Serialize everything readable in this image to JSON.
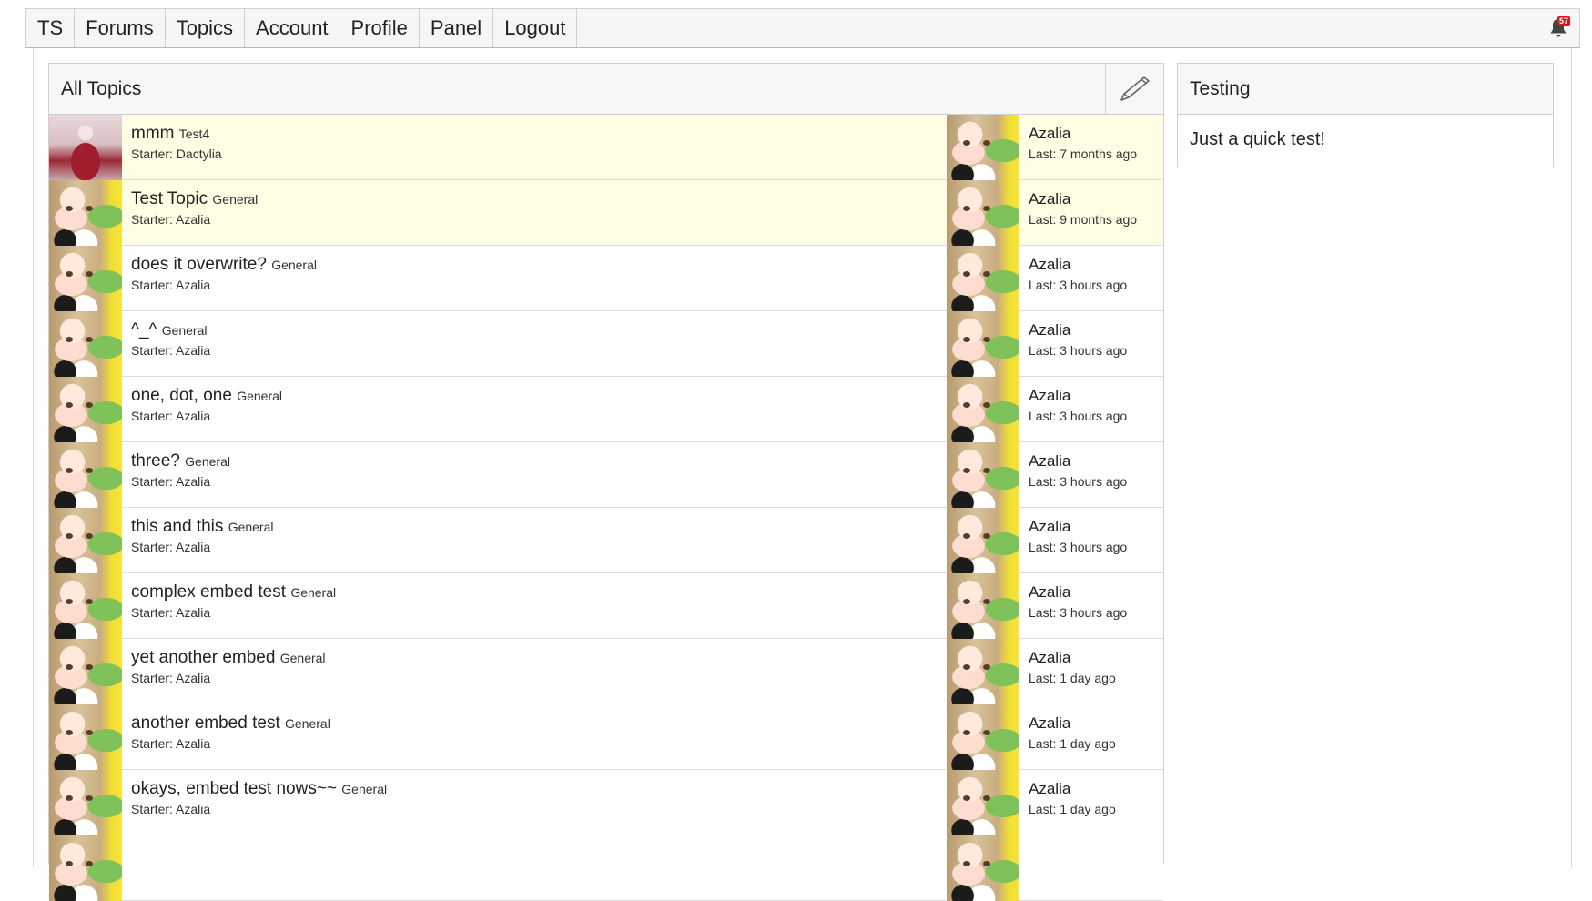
{
  "nav": {
    "brand": "TS",
    "items": [
      "Forums",
      "Topics",
      "Account",
      "Profile",
      "Panel",
      "Logout"
    ],
    "alert_count": "57",
    "alert_icon": "bell-icon"
  },
  "topic_list": {
    "title": "All Topics",
    "option_icon": "pencil-icon",
    "rows": [
      {
        "title": "mmm",
        "forum": "Test4",
        "starter": "Starter: Dactylia",
        "last_user": "Azalia",
        "last_time": "Last: 7 months ago",
        "sticky": true,
        "starter_avatar": "dactylia"
      },
      {
        "title": "Test Topic",
        "forum": "General",
        "starter": "Starter: Azalia",
        "last_user": "Azalia",
        "last_time": "Last: 9 months ago",
        "sticky": true,
        "starter_avatar": "azalia"
      },
      {
        "title": "does it overwrite?",
        "forum": "General",
        "starter": "Starter: Azalia",
        "last_user": "Azalia",
        "last_time": "Last: 3 hours ago",
        "sticky": false,
        "starter_avatar": "azalia"
      },
      {
        "title": "^_^",
        "forum": "General",
        "starter": "Starter: Azalia",
        "last_user": "Azalia",
        "last_time": "Last: 3 hours ago",
        "sticky": false,
        "starter_avatar": "azalia"
      },
      {
        "title": "one, dot, one",
        "forum": "General",
        "starter": "Starter: Azalia",
        "last_user": "Azalia",
        "last_time": "Last: 3 hours ago",
        "sticky": false,
        "starter_avatar": "azalia"
      },
      {
        "title": "three?",
        "forum": "General",
        "starter": "Starter: Azalia",
        "last_user": "Azalia",
        "last_time": "Last: 3 hours ago",
        "sticky": false,
        "starter_avatar": "azalia"
      },
      {
        "title": "this and this",
        "forum": "General",
        "starter": "Starter: Azalia",
        "last_user": "Azalia",
        "last_time": "Last: 3 hours ago",
        "sticky": false,
        "starter_avatar": "azalia"
      },
      {
        "title": "complex embed test",
        "forum": "General",
        "starter": "Starter: Azalia",
        "last_user": "Azalia",
        "last_time": "Last: 3 hours ago",
        "sticky": false,
        "starter_avatar": "azalia"
      },
      {
        "title": "yet another embed",
        "forum": "General",
        "starter": "Starter: Azalia",
        "last_user": "Azalia",
        "last_time": "Last: 1 day ago",
        "sticky": false,
        "starter_avatar": "azalia"
      },
      {
        "title": "another embed test",
        "forum": "General",
        "starter": "Starter: Azalia",
        "last_user": "Azalia",
        "last_time": "Last: 1 day ago",
        "sticky": false,
        "starter_avatar": "azalia"
      },
      {
        "title": "okays, embed test nows~~",
        "forum": "General",
        "starter": "Starter: Azalia",
        "last_user": "Azalia",
        "last_time": "Last: 1 day ago",
        "sticky": false,
        "starter_avatar": "azalia"
      },
      {
        "title": "",
        "forum": "",
        "starter": "",
        "last_user": "",
        "last_time": "",
        "sticky": false,
        "starter_avatar": "azalia"
      }
    ]
  },
  "widget": {
    "title": "Testing",
    "body": "Just a quick test!"
  }
}
